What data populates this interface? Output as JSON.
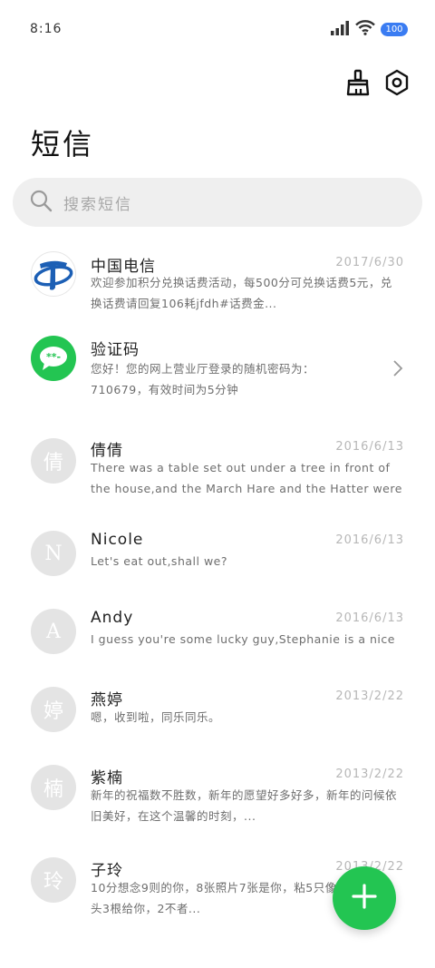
{
  "status_bar": {
    "time": "8:16",
    "battery": "100",
    "icons": [
      "signal-icon",
      "wifi-icon",
      "battery-icon"
    ]
  },
  "toolbar": {
    "icons": [
      "broom-icon",
      "settings-icon"
    ]
  },
  "page": {
    "title": "短信"
  },
  "search": {
    "placeholder": "搜索短信",
    "icon": "search-icon"
  },
  "colors": {
    "fab": "#23c552",
    "telecom_blue": "#1c5fb5",
    "verify_green": "#23c552",
    "avatar_gray": "#e4e4e4",
    "battery_blue": "#3a7cf2"
  },
  "messages": [
    {
      "avatar": "china-telecom-logo",
      "sender": "中国电信",
      "date": "2017/6/30",
      "preview": "欢迎参加积分兑换话费活动，每500分可兑换话费5元，兑换话费请回复106耗jfdh#话费金..."
    },
    {
      "avatar": "message-icon",
      "sender": "验证码",
      "date": "",
      "preview": "您好！您的网上营业厅登录的随机密码为：710679，有效时间为5分钟"
    },
    {
      "avatar_letter": "倩",
      "sender": "倩倩",
      "date": "2016/6/13",
      "preview": "There was a table set out under a tree in front of the house,and the March Hare and the Hatter were having..."
    },
    {
      "avatar_letter": "N",
      "sender": "Nicole",
      "date": "2016/6/13",
      "preview": "Let's eat out,shall we?"
    },
    {
      "avatar_letter": "A",
      "sender": "Andy",
      "date": "2016/6/13",
      "preview": "I guess you're some lucky guy,Stephanie is a nice girl."
    },
    {
      "avatar_letter": "婷",
      "sender": "燕婷",
      "date": "2013/2/22",
      "preview": "嗯，收到啦，同乐同乐。"
    },
    {
      "avatar_letter": "楠",
      "sender": "紫楠",
      "date": "2013/2/22",
      "preview": "新年的祝福数不胜数，新年的愿望好多好多，新年的问候依旧美好，在这个温馨的时刻，..."
    },
    {
      "avatar_letter": "玲",
      "sender": "子玲",
      "date": "2013/2/22",
      "preview": "10分想念9则的你，8张照片7张是你，粘5只像你，4根骨头3根给你，2不者..."
    }
  ]
}
